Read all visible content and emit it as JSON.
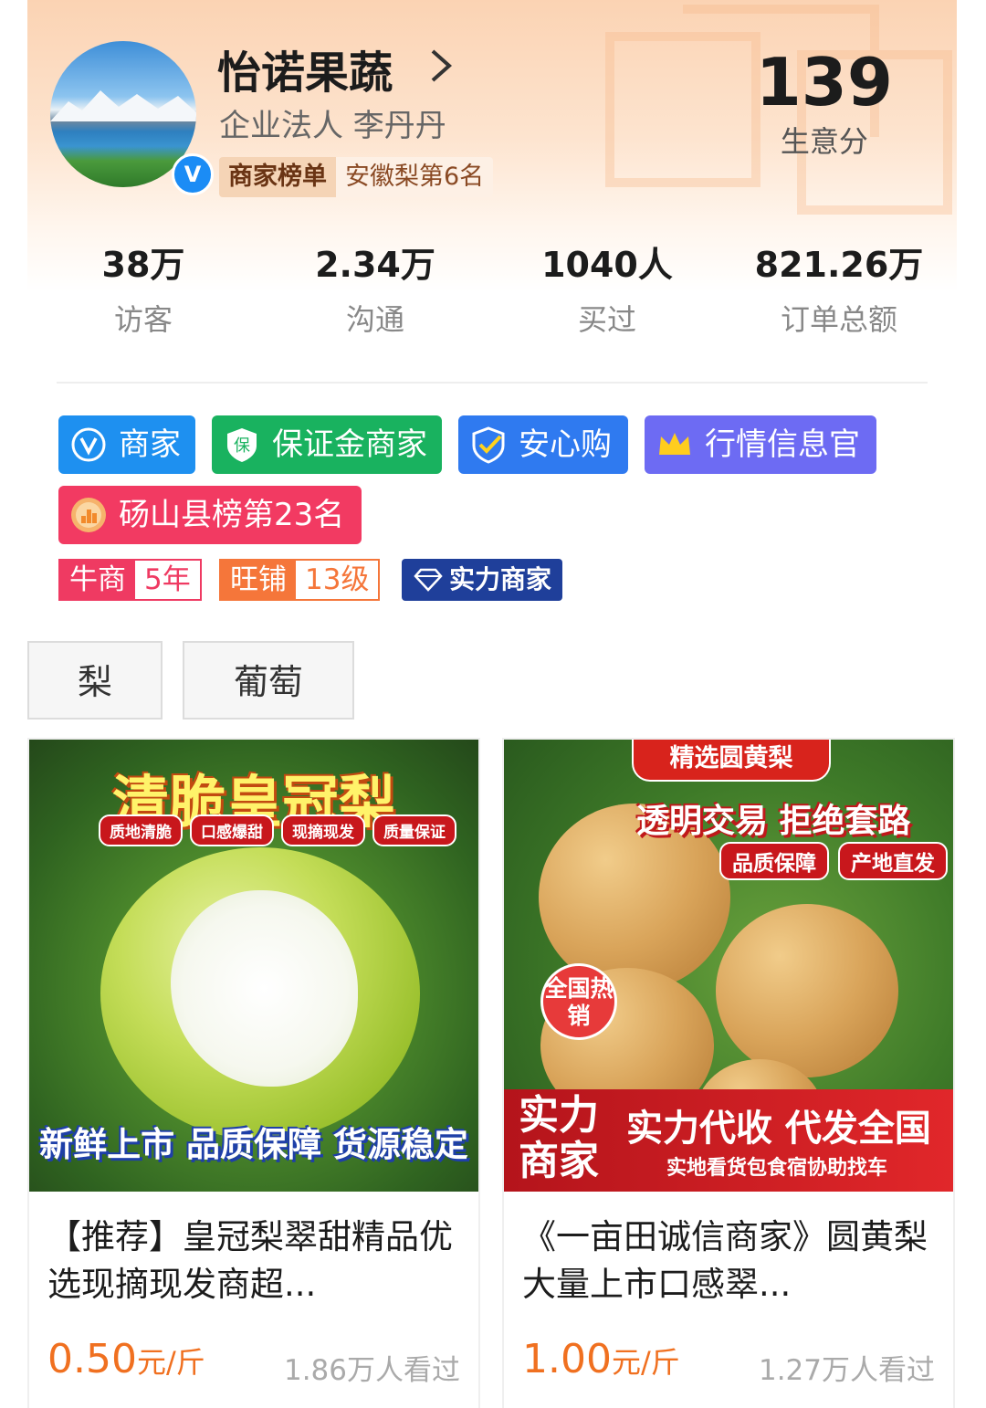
{
  "shop": {
    "name": "怡诺果蔬",
    "legal_person": "企业法人  李丹丹",
    "rank_label": "商家榜单",
    "rank_value": "安徽梨第6名",
    "score": "139",
    "score_label": "生意分",
    "verified_mark": "V"
  },
  "stats": [
    {
      "value": "38万",
      "label": "访客"
    },
    {
      "value": "2.34万",
      "label": "沟通"
    },
    {
      "value": "1040人",
      "label": "买过"
    },
    {
      "value": "821.26万",
      "label": "订单总额"
    }
  ],
  "badges": {
    "merchant": "商家",
    "deposit": "保证金商家",
    "secure": "安心购",
    "market_officer": "行情信息官",
    "county_rank": "砀山县榜第23名"
  },
  "mini_badges": {
    "niushang_label": "牛商",
    "niushang_value": "5年",
    "wangpu_label": "旺铺",
    "wangpu_value": "13级",
    "strong_merchant": "实力商家"
  },
  "tabs": [
    "梨",
    "葡萄"
  ],
  "products": [
    {
      "title": "【推荐】皇冠梨翠甜精品优选现摘现发商超...",
      "price": "0.50",
      "unit": "元/斤",
      "views": "1.86万人看过",
      "image_text": {
        "headline": "清脆皇冠梨",
        "chips": [
          "质地清脆",
          "口感爆甜",
          "现摘现发",
          "质量保证"
        ],
        "footer": "新鲜上市 品质保障 货源稳定"
      }
    },
    {
      "title": "《一亩田诚信商家》圆黄梨大量上市口感翠...",
      "price": "1.00",
      "unit": "元/斤",
      "views": "1.27万人看过",
      "image_text": {
        "ribbon": "精选圆黄梨",
        "slogan": "透明交易 拒绝套路",
        "chips": [
          "品质保障",
          "产地直发"
        ],
        "seal": "全国热销",
        "banner_left": "实力商家",
        "banner_main": "实力代收 代发全国",
        "banner_sub": "实地看货包食宿协助找车"
      }
    }
  ],
  "colors": {
    "price": "#f07020",
    "merchant_badge": "#1e90f0",
    "deposit_badge": "#19b25f",
    "secure_badge": "#2f7af0",
    "officer_badge": "#6d6bf3",
    "county_badge": "#f23a62"
  }
}
